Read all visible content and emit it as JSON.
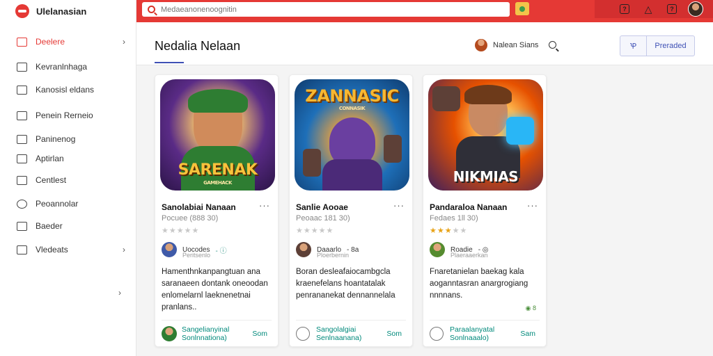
{
  "app": {
    "name": "Ulelanasian"
  },
  "search": {
    "placeholder": "Medaeanonenoognitin"
  },
  "sidebar": {
    "items": [
      {
        "label": "Deelere",
        "icon": "mail-icon",
        "active": true,
        "has_chevron": true
      },
      {
        "label": "Kevranlnhaga",
        "icon": "document-icon",
        "active": false,
        "has_chevron": false
      },
      {
        "label": "Kanosisl eldans",
        "icon": "book-icon",
        "active": false,
        "has_chevron": false
      },
      {
        "label": "Penein Rerneio",
        "icon": "lock-icon",
        "active": false,
        "has_chevron": false
      },
      {
        "label": "Paninenog",
        "icon": "calendar-icon",
        "active": false,
        "has_chevron": false
      },
      {
        "label": "Aptirlan",
        "icon": "folder-icon",
        "active": false,
        "has_chevron": false
      },
      {
        "label": "Centlest",
        "icon": "list-icon",
        "active": false,
        "has_chevron": false
      },
      {
        "label": "Peoannolar",
        "icon": "settings-icon",
        "active": false,
        "has_chevron": false
      },
      {
        "label": "Baeder",
        "icon": "bookmark-icon",
        "active": false,
        "has_chevron": false
      },
      {
        "label": "Vledeats",
        "icon": "video-icon",
        "active": false,
        "has_chevron": true
      }
    ]
  },
  "header": {
    "title": "Nedalia Nelaan",
    "user_label": "Nalean Sians",
    "btn_short": "Ꝕ",
    "btn_primary": "Preraded"
  },
  "colors": {
    "accent": "#e53935",
    "primary": "#3f51b5",
    "teal": "#00897b",
    "star": "#e8a317"
  },
  "cards": [
    {
      "art_title": "SARENAK",
      "art_subtitle": "GAMEHACK",
      "title": "Sanolabiai Nanaan",
      "subtitle": "Pocuee (888 30)",
      "rating": 0,
      "author": "Uocodes",
      "author_meta": "- ⓘ",
      "author_sub": "Peritsenlo",
      "description": "Hamenthnkanpangtuan ana saranaeen dontank oneoodan enlomelarnl laeknenetnai pranlans..",
      "footer": "Sangelianyinal Sonlnnationa)",
      "footer_link": "Som",
      "footer_type": "avatar",
      "badge": ""
    },
    {
      "art_title": "ZANNASIC",
      "art_subtitle": "CONNASIK",
      "title": "Sanlie Aooae",
      "subtitle": "Peoaac 181 30)",
      "rating": 0,
      "author": "Daaarlo",
      "author_meta": "- 8a",
      "author_sub": "Ploerbernin",
      "description": "Boran desleafaiocambgcla kraenefelans hoantatalak penrananekat dennannelala",
      "footer": "Sangolalgiai Senlnaanana)",
      "footer_link": "Som",
      "footer_type": "heart",
      "badge": ""
    },
    {
      "art_title": "NIKMIAS",
      "art_subtitle": "",
      "title": "Pandaraloa Nanaan",
      "subtitle": "Fedaes 1ll 30)",
      "rating": 3,
      "author": "Roadie",
      "author_meta": "- ◎",
      "author_sub": "Plaeraaerkan",
      "description": "Fnaretanielan baekag kala aoganntasran anargrogiang nnnnans.",
      "footer": "Paraalanyatal Sonlnaaalo)",
      "footer_link": "Sam",
      "footer_type": "heart",
      "badge": "◉ 8"
    }
  ]
}
